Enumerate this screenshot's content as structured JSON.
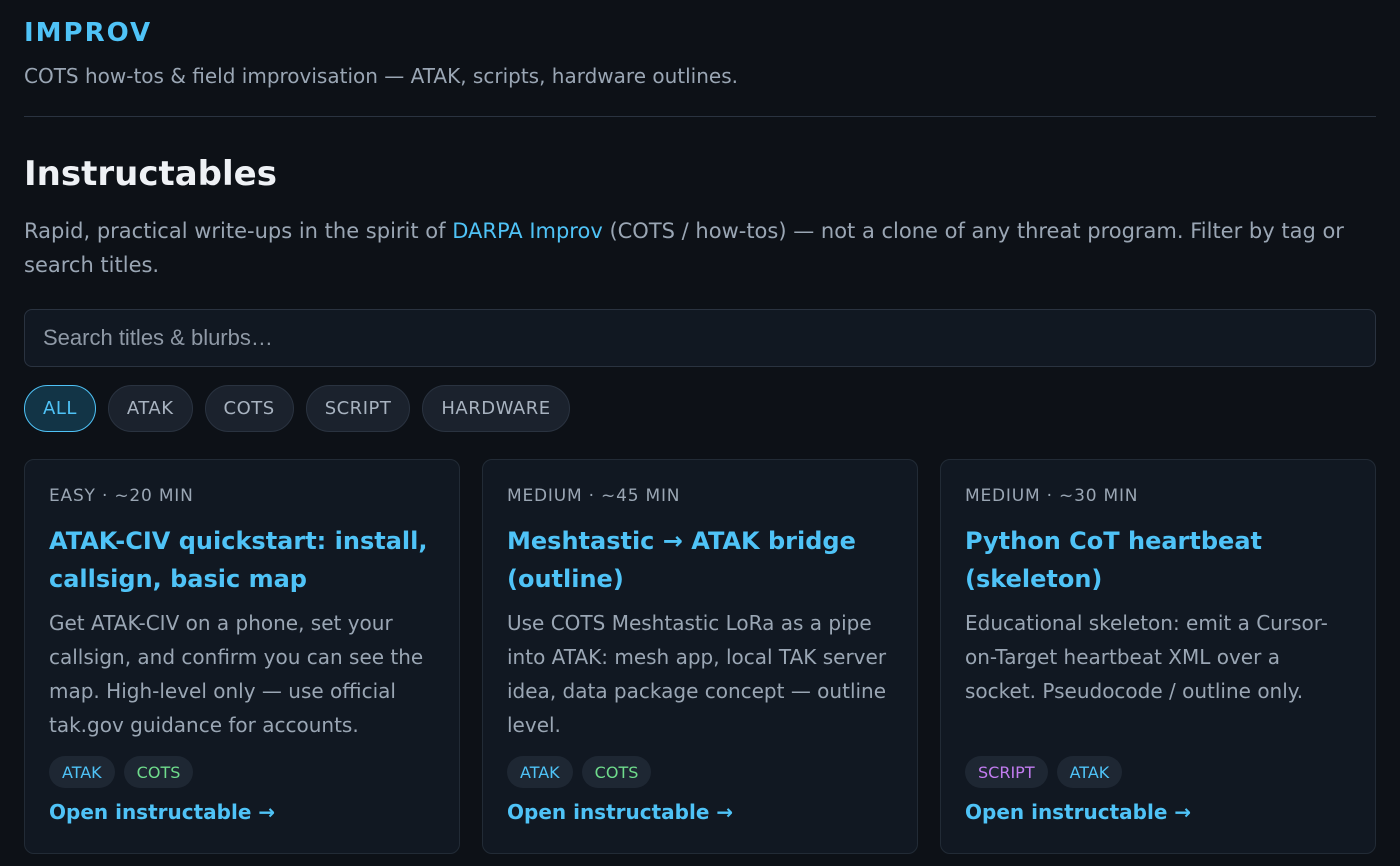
{
  "header": {
    "brand": "IMPROV",
    "tagline": "COTS how-tos & field improvisation — ATAK, scripts, hardware outlines."
  },
  "main": {
    "title": "Instructables",
    "intro_before": "Rapid, practical write-ups in the spirit of ",
    "intro_link": "DARPA Improv",
    "intro_after": " (COTS / how-tos) — not a clone of any threat program. Filter by tag or search titles.",
    "search": {
      "placeholder": "Search titles & blurbs…",
      "value": ""
    },
    "filters": [
      "ALL",
      "ATAK",
      "COTS",
      "SCRIPT",
      "HARDWARE"
    ],
    "active_filter": "ALL",
    "cards": [
      {
        "meta": "EASY · ~20 MIN",
        "title": "ATAK-CIV quickstart: install, callsign, basic map",
        "blurb": "Get ATAK-CIV on a phone, set your callsign, and confirm you can see the map. High-level only — use official tak.gov guidance for accounts.",
        "tags": [
          "ATAK",
          "COTS"
        ],
        "link": "Open instructable →"
      },
      {
        "meta": "MEDIUM · ~45 MIN",
        "title": "Meshtastic → ATAK bridge (outline)",
        "blurb": "Use COTS Meshtastic LoRa as a pipe into ATAK: mesh app, local TAK server idea, data package concept — outline level.",
        "tags": [
          "ATAK",
          "COTS"
        ],
        "link": "Open instructable →"
      },
      {
        "meta": "MEDIUM · ~30 MIN",
        "title": "Python CoT heartbeat (skeleton)",
        "blurb": "Educational skeleton: emit a Cursor-on-Target heartbeat XML over a socket. Pseudocode / outline only.",
        "tags": [
          "SCRIPT",
          "ATAK"
        ],
        "link": "Open instructable →"
      }
    ]
  },
  "colors": {
    "background": "#0d1117",
    "accent": "#4fc3f7",
    "tag_cots": "#6fdc8c",
    "tag_script": "#c27cf0"
  }
}
